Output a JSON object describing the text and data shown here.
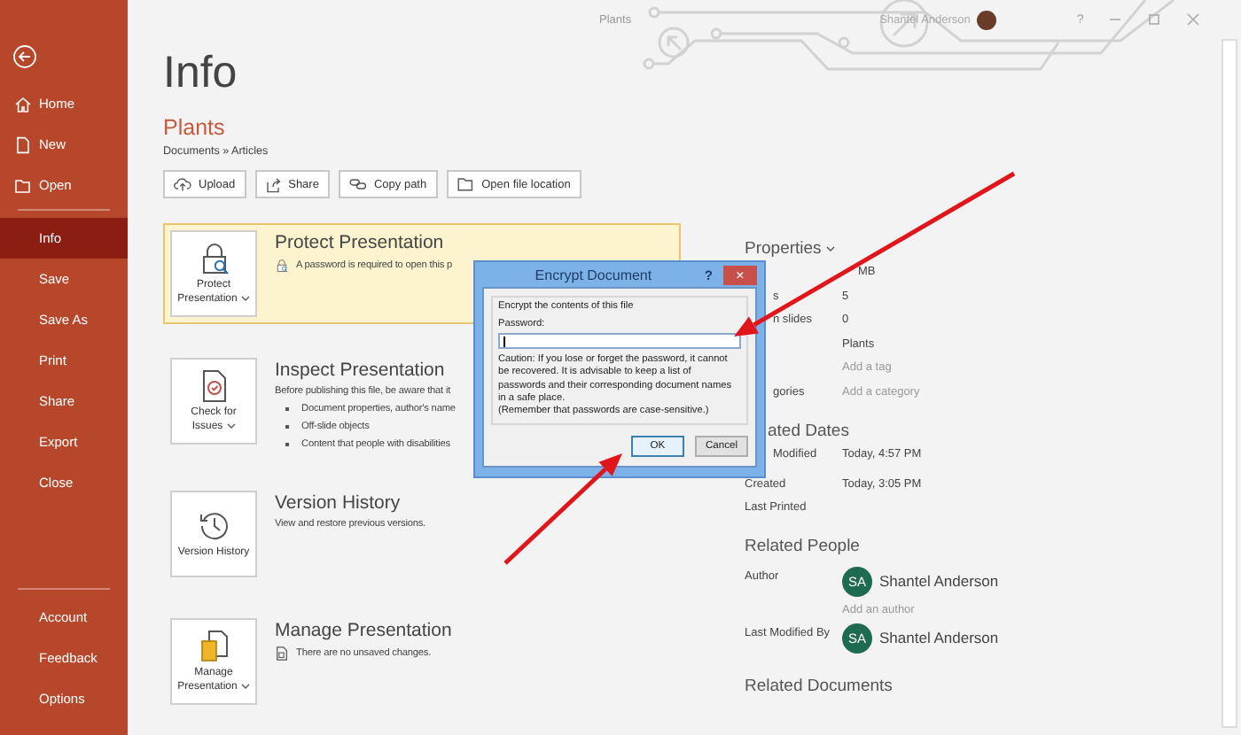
{
  "window": {
    "title": "Plants",
    "user": "Shantel Anderson",
    "help": "?"
  },
  "sidebar": {
    "items": [
      {
        "label": "Home",
        "selected": false
      },
      {
        "label": "New",
        "selected": false
      },
      {
        "label": "Open",
        "selected": false
      },
      {
        "label": "Info",
        "selected": true
      },
      {
        "label": "Save",
        "selected": false
      },
      {
        "label": "Save As",
        "selected": false
      },
      {
        "label": "Print",
        "selected": false
      },
      {
        "label": "Share",
        "selected": false
      },
      {
        "label": "Export",
        "selected": false
      },
      {
        "label": "Close",
        "selected": false
      }
    ],
    "footer_items": [
      {
        "label": "Account",
        "selected": false
      },
      {
        "label": "Feedback",
        "selected": false
      },
      {
        "label": "Options",
        "selected": false
      }
    ]
  },
  "page": {
    "heading": "Info",
    "file_name": "Plants",
    "path": "Documents » Articles",
    "actions": [
      {
        "label": "Upload"
      },
      {
        "label": "Share"
      },
      {
        "label": "Copy path"
      },
      {
        "label": "Open file location"
      }
    ]
  },
  "sections": [
    {
      "title": "Protect Presentation",
      "tile_label": "Protect Presentation",
      "dropdown": true,
      "highlighted": true,
      "description": "A password is required to open this p"
    },
    {
      "title": "Inspect Presentation",
      "tile_label": "Check for Issues",
      "dropdown": true,
      "highlighted": false,
      "description": "Before publishing this file, be aware that it",
      "bullets": [
        "Document properties, author's name",
        "Off-slide objects",
        "Content that people with disabilities"
      ]
    },
    {
      "title": "Version History",
      "tile_label": "Version History",
      "dropdown": false,
      "highlighted": false,
      "description": "View and restore previous versions."
    },
    {
      "title": "Manage Presentation",
      "tile_label": "Manage Presentation",
      "dropdown": true,
      "highlighted": false,
      "description": "There are no unsaved changes."
    }
  ],
  "properties": {
    "title": "Properties",
    "rows": [
      {
        "value": "MB",
        "kind": "text"
      },
      {
        "label": "s",
        "value": "5",
        "kind": "text"
      },
      {
        "label": "n slides",
        "value": "0",
        "kind": "text"
      },
      {
        "value": "Plants",
        "kind": "text"
      },
      {
        "value": "Add a tag",
        "kind": "hint"
      },
      {
        "label": "gories",
        "value": "Add a category",
        "kind": "hint"
      }
    ]
  },
  "related_dates": {
    "title": "ated Dates",
    "rows": [
      {
        "label": "Modified",
        "value": "Today, 4:57 PM"
      },
      {
        "label": "Created",
        "value": "Today, 3:05 PM"
      },
      {
        "label": "Last Printed"
      }
    ]
  },
  "related_people": {
    "title": "Related People",
    "groups": [
      {
        "label": "Author",
        "person": {
          "initials": "SA",
          "name": "Shantel Anderson"
        },
        "add": "Add an author"
      },
      {
        "label": "Last Modified By",
        "person": {
          "initials": "SA",
          "name": "Shantel Anderson"
        }
      }
    ]
  },
  "related_documents": {
    "title": "Related Documents"
  },
  "dialog": {
    "title": "Encrypt Document",
    "help": "?",
    "close": "×",
    "group_label": "Encrypt the contents of this file",
    "field_label": "Password:",
    "caution": "Caution: If you lose or forget the password, it cannot be recovered. It is advisable to keep a list of passwords and their corresponding document names in a safe place.",
    "note": "(Remember that passwords are case-sensitive.)",
    "buttons": [
      {
        "label": "OK",
        "default": true
      },
      {
        "label": "Cancel",
        "default": false
      }
    ]
  },
  "annotations": [
    {
      "kind": "arrow"
    },
    {
      "kind": "arrow"
    }
  ]
}
